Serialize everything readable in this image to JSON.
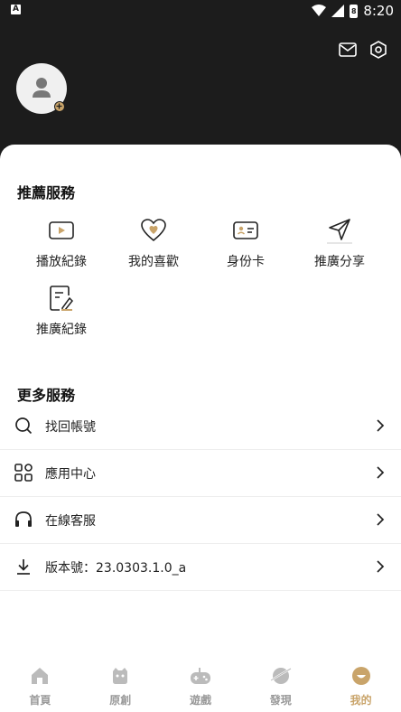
{
  "status_bar": {
    "time": "8:20",
    "battery": "8",
    "left_icon": "A"
  },
  "top_icons": [
    "mail-icon",
    "settings-icon"
  ],
  "sections": {
    "recommended_title": "推薦服務",
    "recommended": [
      {
        "label": "播放紀錄",
        "icon": "play-record-icon"
      },
      {
        "label": "我的喜歡",
        "icon": "heart-icon"
      },
      {
        "label": "身份卡",
        "icon": "id-card-icon"
      },
      {
        "label": "推廣分享",
        "icon": "send-icon"
      },
      {
        "label": "推廣紀錄",
        "icon": "promo-record-icon"
      }
    ],
    "more_title": "更多服務",
    "more": [
      {
        "label": "找回帳號",
        "icon": "search-icon"
      },
      {
        "label": "應用中心",
        "icon": "apps-icon"
      },
      {
        "label": "在線客服",
        "icon": "headphones-icon"
      },
      {
        "label": "版本號：23.0303.1.0_a",
        "icon": "download-icon"
      }
    ]
  },
  "tabbar": [
    {
      "label": "首頁",
      "icon": "home-icon",
      "active": false
    },
    {
      "label": "原創",
      "icon": "original-icon",
      "active": false
    },
    {
      "label": "遊戲",
      "icon": "gamepad-icon",
      "active": false
    },
    {
      "label": "發現",
      "icon": "discover-icon",
      "active": false
    },
    {
      "label": "我的",
      "icon": "profile-icon",
      "active": true
    }
  ],
  "colors": {
    "accent": "#c9a46a",
    "header_bg": "#1c1c1c"
  }
}
